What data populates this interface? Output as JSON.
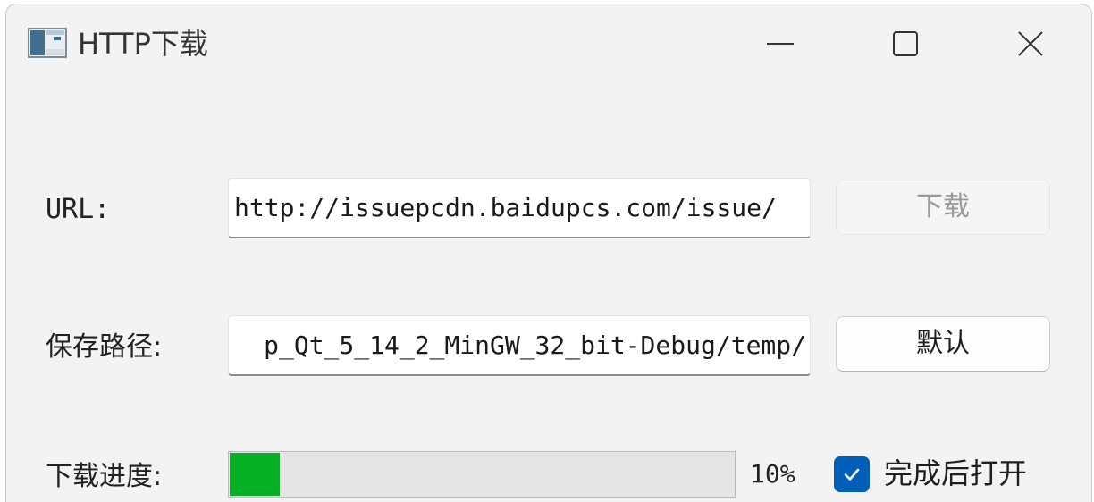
{
  "window": {
    "title": "HTTP下载",
    "icon": "app-window-icon",
    "controls": {
      "minimize_icon": "minimize-icon",
      "maximize_icon": "maximize-icon",
      "close_icon": "close-icon"
    }
  },
  "form": {
    "url_label": "URL:",
    "url_value": "http://issuepcdn.baidupcs.com/issue/",
    "download_button": "下载",
    "path_label": "保存路径:",
    "path_value": "p_Qt_5_14_2_MinGW_32_bit-Debug/temp/",
    "default_button": "默认",
    "progress_label": "下载进度:",
    "progress_value": 0.1,
    "progress_text": "10%",
    "open_after_label": "完成后打开",
    "open_after_checked": true
  },
  "colors": {
    "accent": "#005fb8",
    "progress_fill": "#06b025",
    "window_bg": "#f3f3f3"
  }
}
